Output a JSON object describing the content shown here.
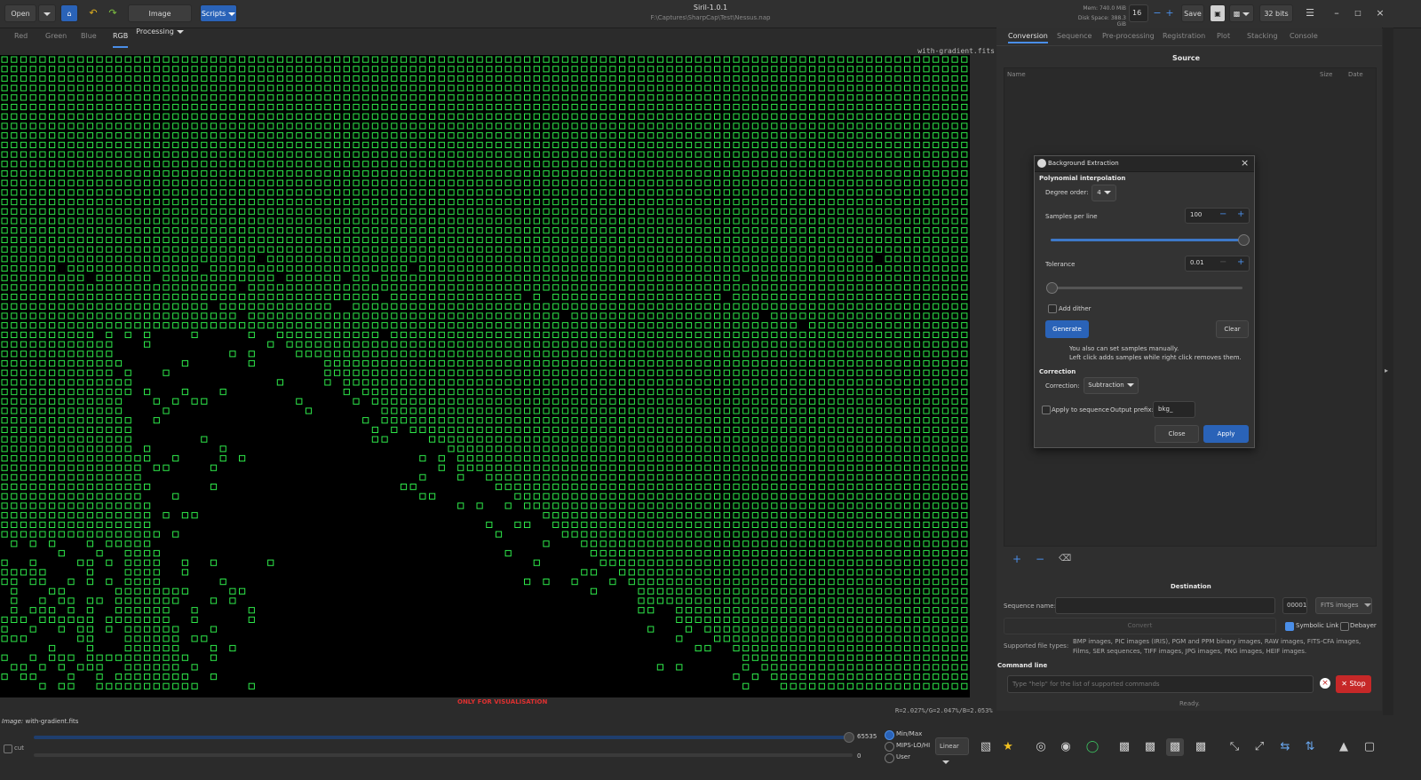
{
  "header": {
    "open_label": "Open",
    "image_processing_label": "Image Processing",
    "scripts_label": "Scripts",
    "title": "Siril-1.0.1",
    "path": "F:\\Captures\\SharpCap\\Test\\Nessus.nap",
    "mem": "Mem: 740.0 MiB",
    "disk": "Disk Space: 388.3 GiB",
    "threads_value": "16",
    "save_label": "Save",
    "bits_label": "32 bits"
  },
  "left_tabs": [
    "Red",
    "Green",
    "Blue",
    "RGB"
  ],
  "image": {
    "filename": "with-gradient.fits",
    "vis_label": "ONLY FOR VISUALISATION",
    "pixel_readout": "R=2.027%/G=2.047%/B=2.053%"
  },
  "right_tabs": [
    "Conversion",
    "Sequence",
    "Pre-processing",
    "Registration",
    "Plot",
    "Stacking",
    "Console"
  ],
  "conversion": {
    "source_title": "Source",
    "col_name": "Name",
    "col_size": "Size",
    "col_date": "Date",
    "destination_title": "Destination",
    "sequence_name_label": "Sequence name:",
    "sequence_index": "00001",
    "format_select": "FITS images",
    "convert_label": "Convert",
    "symbolic_link_label": "Symbolic Link",
    "debayer_label": "Debayer",
    "supported_label": "Supported file types:",
    "supported_text": "BMP images, PIC images (IRIS), PGM and PPM binary images, RAW images, FITS-CFA images, Films, SER sequences, TIFF images, JPG images, PNG images, HEIF images."
  },
  "command_line": {
    "title": "Command line",
    "placeholder": "Type \"help\" for the list of supported commands",
    "stop_label": "Stop",
    "status": "Ready."
  },
  "dialog": {
    "title": "Background Extraction",
    "poly_section": "Polynomial interpolation",
    "degree_label": "Degree order:",
    "degree_value": "4",
    "samples_label": "Samples per line",
    "samples_value": "100",
    "samples_level": 1.0,
    "tolerance_label": "Tolerance",
    "tolerance_value": "0.01",
    "tolerance_level": 0.0,
    "dither_label": "Add dither",
    "generate_label": "Generate",
    "clear_label": "Clear",
    "hint_line1": "You also can set samples manually.",
    "hint_line2": "Left click adds samples while right click removes them.",
    "correction_section": "Correction",
    "correction_label": "Correction:",
    "correction_value": "Subtraction",
    "apply_seq_label": "Apply to sequence",
    "output_prefix_label": "Output prefix:",
    "output_prefix_value": "bkg_",
    "close_label": "Close",
    "apply_label": "Apply"
  },
  "bottom": {
    "image_label": "Image:",
    "image_name": "with-gradient.fits",
    "cut_label": "cut",
    "max_value": "65535",
    "min_value": "0",
    "range_options": [
      "Min/Max",
      "MIPS-LO/HI",
      "User"
    ],
    "range_selected": "Min/Max",
    "scale_select": "Linear"
  },
  "colors": {
    "accent": "#2a63b8",
    "grid": "#2ee84a",
    "stop": "#c62828"
  }
}
